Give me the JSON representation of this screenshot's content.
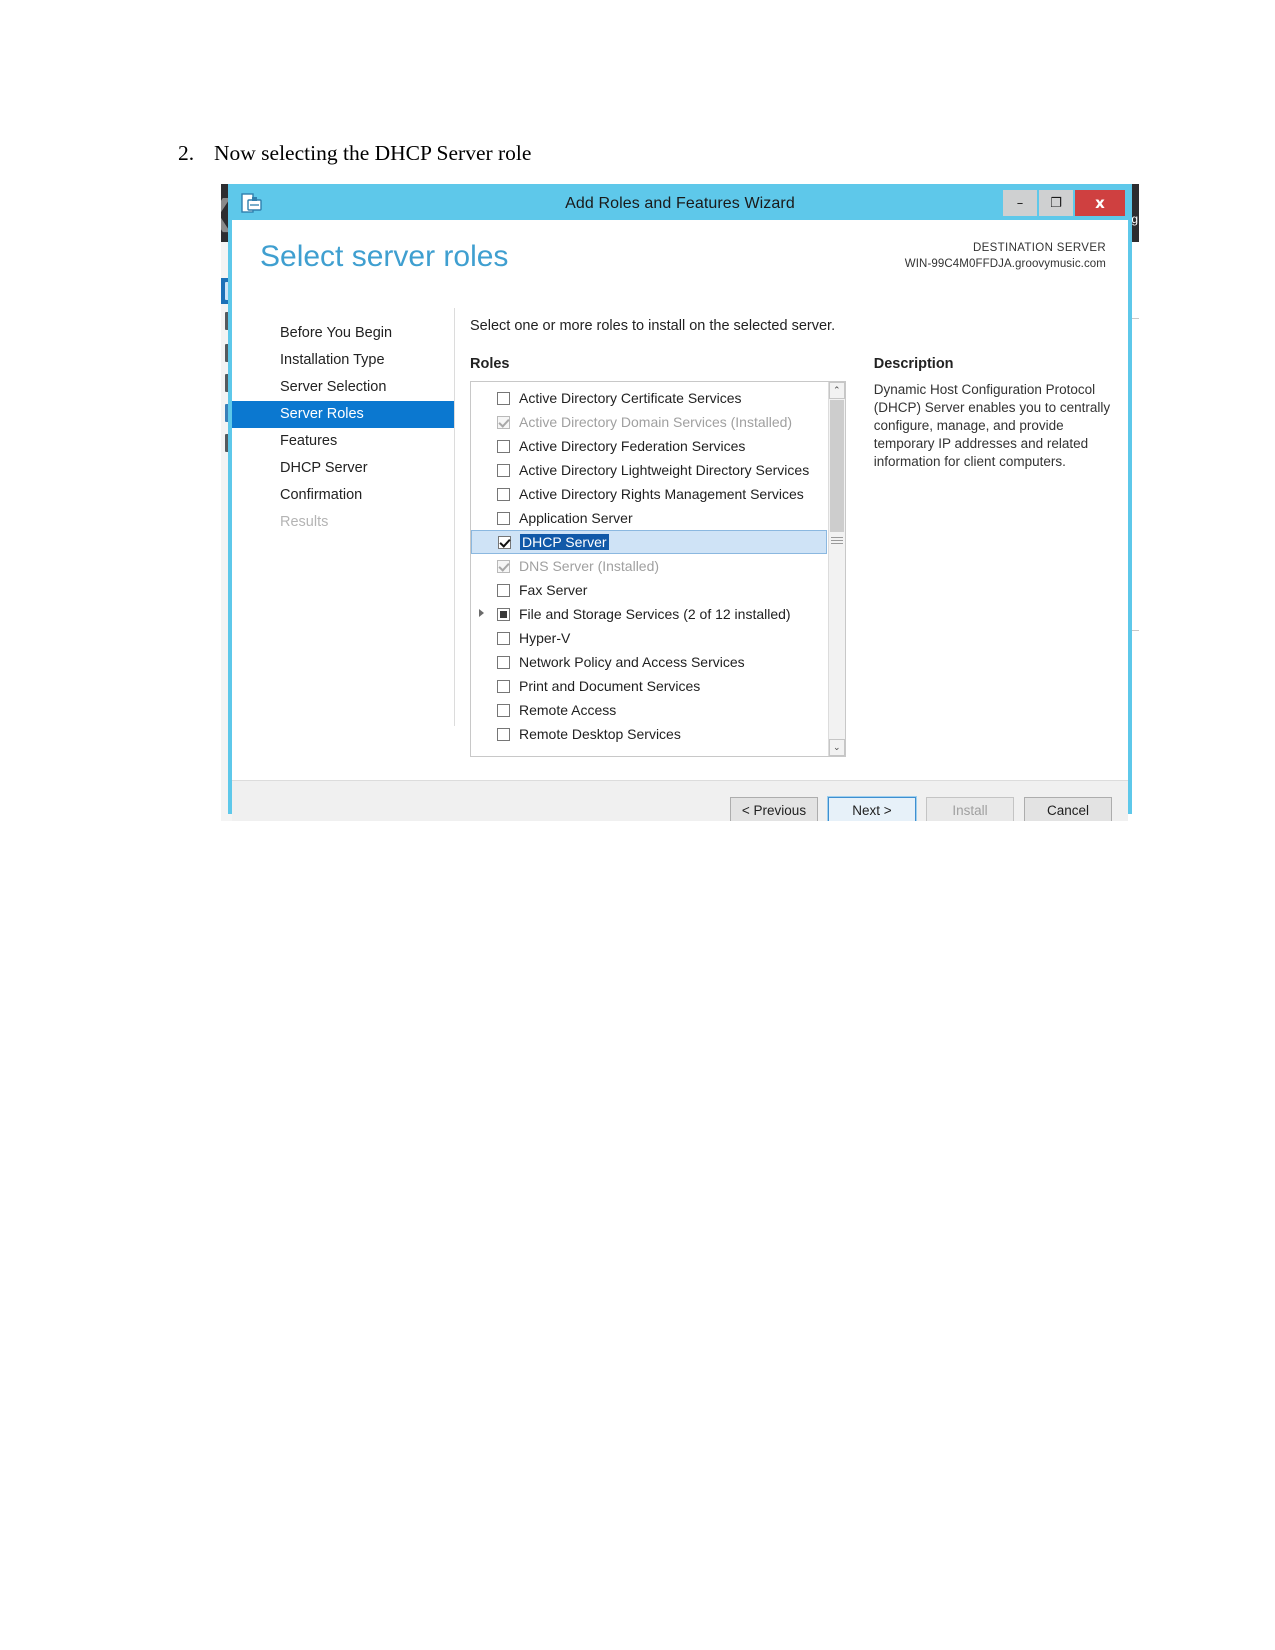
{
  "document": {
    "number": "2.",
    "text": "Now selecting the DHCP Server role"
  },
  "background": {
    "right_edge_text": "g"
  },
  "window": {
    "title": "Add Roles and Features Wizard",
    "icon": "wizard-icon",
    "minimize": "–",
    "maximize": "❐",
    "close": "x",
    "titlebar_color": "#5ec8ea"
  },
  "page": {
    "title": "Select server roles",
    "destination_label": "DESTINATION SERVER",
    "destination_server": "WIN-99C4M0FFDJA.groovymusic.com",
    "intro": "Select one or more roles to install on the selected server."
  },
  "nav": {
    "items": [
      {
        "label": "Before You Begin",
        "state": "normal"
      },
      {
        "label": "Installation Type",
        "state": "normal"
      },
      {
        "label": "Server Selection",
        "state": "normal"
      },
      {
        "label": "Server Roles",
        "state": "active"
      },
      {
        "label": "Features",
        "state": "normal"
      },
      {
        "label": "DHCP Server",
        "state": "normal"
      },
      {
        "label": "Confirmation",
        "state": "normal"
      },
      {
        "label": "Results",
        "state": "disabled"
      }
    ]
  },
  "roles": {
    "heading": "Roles",
    "items": [
      {
        "label": "Active Directory Certificate Services",
        "checked": false,
        "installed": false,
        "expandable": false,
        "selected": false
      },
      {
        "label": "Active Directory Domain Services (Installed)",
        "checked": true,
        "installed": true,
        "expandable": false,
        "selected": false
      },
      {
        "label": "Active Directory Federation Services",
        "checked": false,
        "installed": false,
        "expandable": false,
        "selected": false
      },
      {
        "label": "Active Directory Lightweight Directory Services",
        "checked": false,
        "installed": false,
        "expandable": false,
        "selected": false
      },
      {
        "label": "Active Directory Rights Management Services",
        "checked": false,
        "installed": false,
        "expandable": false,
        "selected": false
      },
      {
        "label": "Application Server",
        "checked": false,
        "installed": false,
        "expandable": false,
        "selected": false
      },
      {
        "label": "DHCP Server",
        "checked": true,
        "installed": false,
        "expandable": false,
        "selected": true
      },
      {
        "label": "DNS Server (Installed)",
        "checked": true,
        "installed": true,
        "expandable": false,
        "selected": false
      },
      {
        "label": "Fax Server",
        "checked": false,
        "installed": false,
        "expandable": false,
        "selected": false
      },
      {
        "label": "File and Storage Services (2 of 12 installed)",
        "checked": false,
        "installed": false,
        "expandable": true,
        "partial": true,
        "selected": false
      },
      {
        "label": "Hyper-V",
        "checked": false,
        "installed": false,
        "expandable": false,
        "selected": false
      },
      {
        "label": "Network Policy and Access Services",
        "checked": false,
        "installed": false,
        "expandable": false,
        "selected": false
      },
      {
        "label": "Print and Document Services",
        "checked": false,
        "installed": false,
        "expandable": false,
        "selected": false
      },
      {
        "label": "Remote Access",
        "checked": false,
        "installed": false,
        "expandable": false,
        "selected": false
      },
      {
        "label": "Remote Desktop Services",
        "checked": false,
        "installed": false,
        "expandable": false,
        "selected": false
      }
    ],
    "scroll_up": "⌃",
    "scroll_down": "⌄"
  },
  "description": {
    "heading": "Description",
    "text": "Dynamic Host Configuration Protocol (DHCP) Server enables you to centrally configure, manage, and provide temporary IP addresses and related information for client computers."
  },
  "footer": {
    "buttons": [
      {
        "label": "< Previous",
        "state": "normal"
      },
      {
        "label": "Next >",
        "state": "focus"
      },
      {
        "label": "Install",
        "state": "disabled"
      },
      {
        "label": "Cancel",
        "state": "normal"
      }
    ]
  }
}
